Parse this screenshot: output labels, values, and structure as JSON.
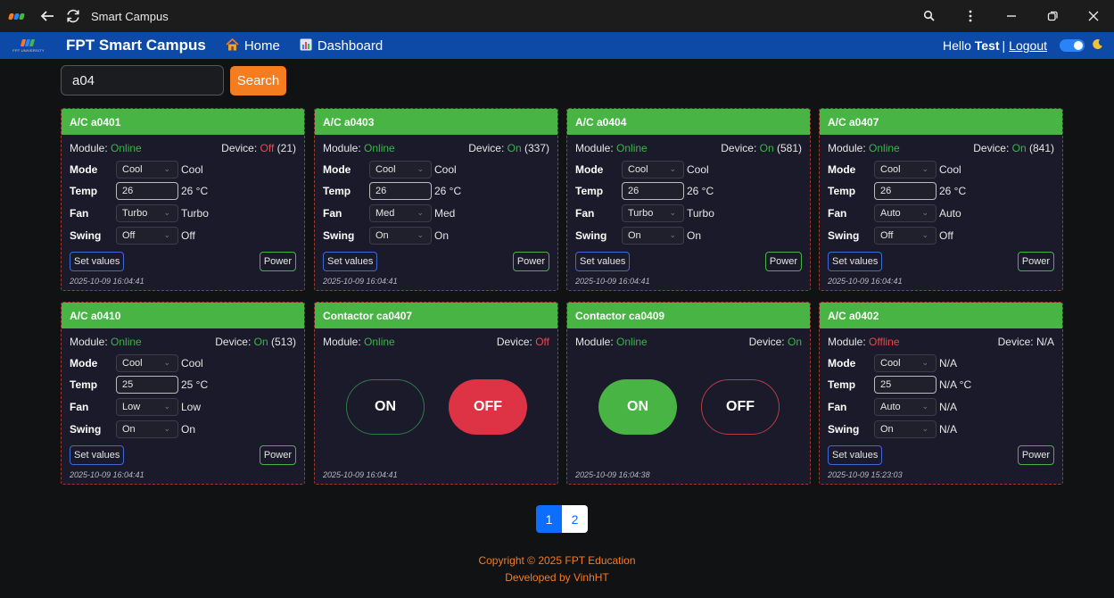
{
  "window": {
    "title": "Smart Campus"
  },
  "navbar": {
    "brand": "FPT Smart Campus",
    "logo_sub": "FPT UNIVERSITY",
    "home": "Home",
    "dashboard": "Dashboard",
    "greeting": "Hello",
    "user": "Test",
    "separator": "|",
    "logout": "Logout"
  },
  "search": {
    "value": "a04",
    "button": "Search"
  },
  "labels": {
    "module": "Module:",
    "device": "Device:",
    "mode": "Mode",
    "temp": "Temp",
    "fan": "Fan",
    "swing": "Swing",
    "set_values": "Set values",
    "power": "Power",
    "on": "ON",
    "off": "OFF"
  },
  "cards": [
    {
      "title": "A/C a0401",
      "module": "Online",
      "device": "Off",
      "count": "(21)",
      "mode": "Cool",
      "mode_val": "Cool",
      "temp": "26",
      "temp_val": "26 °C",
      "fan": "Turbo",
      "fan_val": "Turbo",
      "swing": "Off",
      "swing_val": "Off",
      "timestamp": "2025-10-09 16:04:41"
    },
    {
      "title": "A/C a0403",
      "module": "Online",
      "device": "On",
      "count": "(337)",
      "mode": "Cool",
      "mode_val": "Cool",
      "temp": "26",
      "temp_val": "26 °C",
      "fan": "Med",
      "fan_val": "Med",
      "swing": "On",
      "swing_val": "On",
      "timestamp": "2025-10-09 16:04:41"
    },
    {
      "title": "A/C a0404",
      "module": "Online",
      "device": "On",
      "count": "(581)",
      "mode": "Cool",
      "mode_val": "Cool",
      "temp": "26",
      "temp_val": "26 °C",
      "fan": "Turbo",
      "fan_val": "Turbo",
      "swing": "On",
      "swing_val": "On",
      "timestamp": "2025-10-09 16:04:41"
    },
    {
      "title": "A/C a0407",
      "module": "Online",
      "device": "On",
      "count": "(841)",
      "mode": "Cool",
      "mode_val": "Cool",
      "temp": "26",
      "temp_val": "26 °C",
      "fan": "Auto",
      "fan_val": "Auto",
      "swing": "Off",
      "swing_val": "Off",
      "timestamp": "2025-10-09 16:04:41"
    },
    {
      "title": "A/C a0410",
      "module": "Online",
      "device": "On",
      "count": "(513)",
      "mode": "Cool",
      "mode_val": "Cool",
      "temp": "25",
      "temp_val": "25 °C",
      "fan": "Low",
      "fan_val": "Low",
      "swing": "On",
      "swing_val": "On",
      "timestamp": "2025-10-09 16:04:41"
    },
    {
      "title": "Contactor ca0407",
      "module": "Online",
      "device": "Off",
      "timestamp": "2025-10-09 16:04:41"
    },
    {
      "title": "Contactor ca0409",
      "module": "Online",
      "device": "On",
      "timestamp": "2025-10-09 16:04:38"
    },
    {
      "title": "A/C a0402",
      "module": "Offline",
      "device": "N/A",
      "mode": "Cool",
      "mode_val": "N/A",
      "temp": "25",
      "temp_val": "N/A °C",
      "fan": "Auto",
      "fan_val": "N/A",
      "swing": "On",
      "swing_val": "N/A",
      "timestamp": "2025-10-09 15:23:03"
    }
  ],
  "pagination": {
    "pages": [
      "1",
      "2"
    ],
    "current": "1"
  },
  "footer": {
    "copyright": "Copyright © 2025 FPT Education",
    "developer": "Developed by VinhHT"
  },
  "colors": {
    "navbar": "#0d4aa7",
    "card_header": "#47b444",
    "accent_orange": "#f57c1f",
    "online": "#3bb54a",
    "offline": "#e84a4a"
  }
}
